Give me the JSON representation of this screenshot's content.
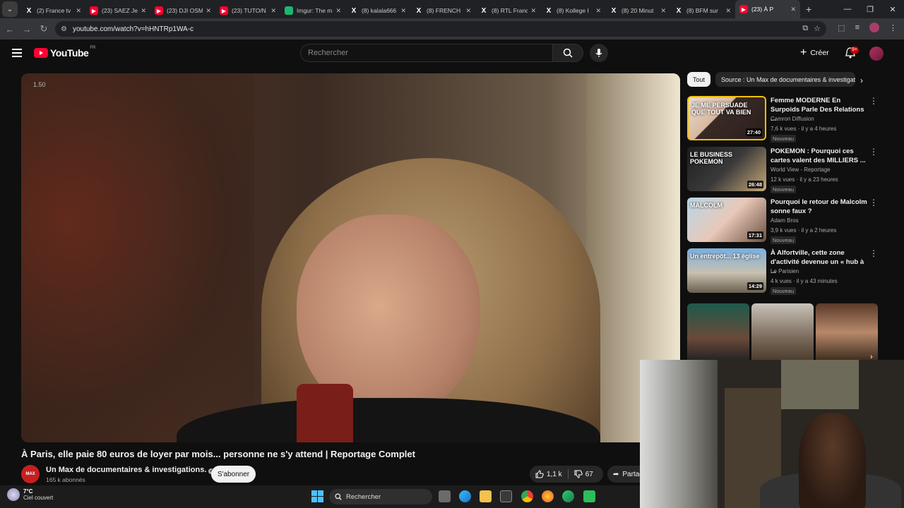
{
  "browser": {
    "tabs": [
      {
        "title": "(2) France tv",
        "icon": "x-icon"
      },
      {
        "title": "(23) SAEZ Je",
        "icon": "youtube-icon"
      },
      {
        "title": "(23) DJI OSM",
        "icon": "youtube-icon"
      },
      {
        "title": "(23) TUTO/N",
        "icon": "youtube-icon"
      },
      {
        "title": "Imgur: The m",
        "icon": "imgur-icon"
      },
      {
        "title": "(8) kalala666",
        "icon": "x-icon"
      },
      {
        "title": "(8) FRENCH",
        "icon": "x-icon"
      },
      {
        "title": "(8) RTL Franc",
        "icon": "x-icon"
      },
      {
        "title": "(8) Kollege I",
        "icon": "x-icon"
      },
      {
        "title": "(8) 20 Minut",
        "icon": "x-icon"
      },
      {
        "title": "(8) BFM sur",
        "icon": "x-icon"
      },
      {
        "title": "(23) À P",
        "icon": "youtube-icon",
        "active": true
      }
    ],
    "url": "youtube.com/watch?v=hHNTRp1WA-c"
  },
  "header": {
    "logo_text": "YouTube",
    "country_code": "FR",
    "search_placeholder": "Rechercher",
    "create_label": "Créer",
    "notif_count": "9+"
  },
  "player": {
    "speed_label": "1.50"
  },
  "video": {
    "title": "À Paris, elle paie 80 euros de loyer par mois... personne ne s'y attend | Reportage Complet",
    "channel_name": "Un Max de documentaires & investigations.",
    "channel_avatar_text": "MAX",
    "subscribers": "165 k abonnés",
    "subscribe_label": "S'abonner",
    "likes": "1,1 k",
    "dislikes": "67",
    "share_label": "Partager"
  },
  "chips": [
    "Tout",
    "Source : Un Max de documentaires & investigations."
  ],
  "recommendations": [
    {
      "title": "Femme MODERNE En Surpoids Parle Des Relations ...",
      "channel": "Camron Diffusion",
      "meta": "7,6 k vues · il y a 4 heures",
      "badge": "Nouveau",
      "duration": "27:40",
      "thumb_text": "JE ME PERSUADE QUE TOUT VA BIEN"
    },
    {
      "title": "POKEMON : Pourquoi ces cartes valent des MILLIERS ...",
      "channel": "World View - Reportage",
      "meta": "12 k vues · il y a 23 heures",
      "badge": "Nouveau",
      "duration": "26:48",
      "thumb_text": "LE BUSINESS POKEMON"
    },
    {
      "title": "Pourquoi le retour de Malcolm sonne faux ?",
      "channel": "Adam Bros",
      "meta": "3,9 k vues · il y a 2 heures",
      "badge": "Nouveau",
      "duration": "17:31",
      "thumb_text": "MALCOLM"
    },
    {
      "title": "À Alfortville, cette zone d'activité devenue un « hub à ...",
      "channel": "Le Parisien",
      "meta": "4 k vues · il y a 43 minutes",
      "badge": "Nouveau",
      "duration": "14:29",
      "thumb_text": "Un entrepôt... 13 église"
    }
  ],
  "taskbar": {
    "temperature": "7°C",
    "weather": "Ciel couvert",
    "search_label": "Rechercher"
  },
  "colors": {
    "yt_red": "#ff0033",
    "bg": "#0f0f0f",
    "chip_bg": "#272727"
  }
}
